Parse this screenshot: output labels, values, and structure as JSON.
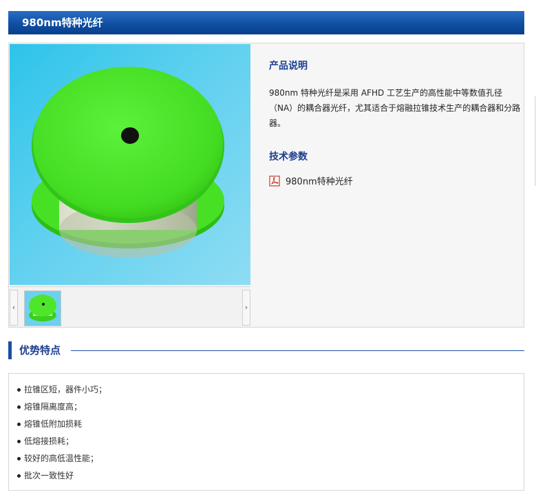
{
  "page": {
    "title": "980nm特种光纤"
  },
  "product": {
    "image_alt": "green fiber spool",
    "description_heading": "产品说明",
    "description": "980nm 特种光纤是采用 AFHD 工艺生产的高性能中等数值孔径（NA）的耦合器光纤，尤其适合于熔融拉锥技术生产的耦合器和分路器。",
    "tech_heading": "技术参数",
    "document_link": "980nm特种光纤",
    "document_icon": "pdf-icon"
  },
  "gallery": {
    "prev_icon": "‹",
    "next_icon": "›"
  },
  "features": {
    "title": "优势特点",
    "items": [
      "拉锥区短，器件小巧；",
      "熔锥隔离度高；",
      "熔锥低附加损耗",
      "低熔接损耗；",
      "较好的高低温性能；",
      "批次一致性好"
    ]
  },
  "colors": {
    "title_bar": "#0f4fa3",
    "heading": "#1b3f8f",
    "spool_green": "#4ee62a",
    "image_bg": "#5fd0ef"
  }
}
